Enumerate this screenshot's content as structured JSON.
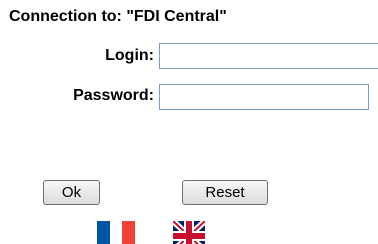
{
  "form": {
    "title": "Connection to: \"FDI Central\"",
    "login_label": "Login:",
    "login_value": "",
    "password_label": "Password:",
    "password_value": ""
  },
  "buttons": {
    "ok_label": "Ok",
    "reset_label": "Reset"
  },
  "languages": [
    {
      "icon": "french-flag-icon",
      "colors": [
        "#0055a4",
        "#ffffff",
        "#ef4135"
      ]
    },
    {
      "icon": "uk-flag-icon",
      "colors": [
        "#012169",
        "#ffffff",
        "#c8102e"
      ]
    }
  ]
}
